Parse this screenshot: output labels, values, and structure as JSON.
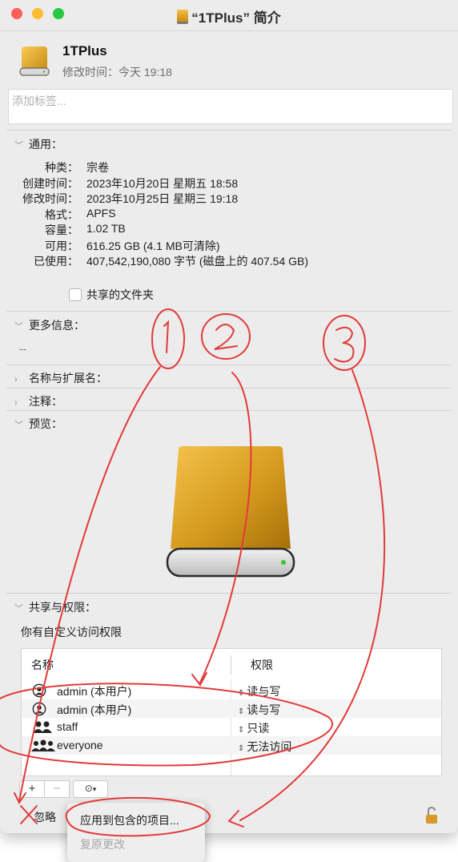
{
  "window": {
    "title": "“1TPlus” 简介",
    "name": "1TPlus",
    "modified": "修改时间：今天 19:18",
    "tag_placeholder": "添加标签..."
  },
  "general": {
    "header": "通用：",
    "rows": [
      {
        "label": "种类：",
        "value": "宗卷"
      },
      {
        "label": "创建时间：",
        "value": "2023年10月20日 星期五 18:58"
      },
      {
        "label": "修改时间：",
        "value": "2023年10月25日 星期三 19:18"
      },
      {
        "label": "格式：",
        "value": "APFS"
      },
      {
        "label": "容量：",
        "value": "1.02 TB"
      },
      {
        "label": "可用：",
        "value": "616.25 GB (4.1 MB可清除)"
      },
      {
        "label": "已使用：",
        "value": "407,542,190,080 字节 (磁盘上的 407.54 GB)"
      }
    ],
    "shared_folder": "共享的文件夹"
  },
  "more_info": {
    "header": "更多信息：",
    "value": "--"
  },
  "name_ext": {
    "header": "名称与扩展名："
  },
  "comments": {
    "header": "注释："
  },
  "preview": {
    "header": "预览："
  },
  "sharing": {
    "header": "共享与权限：",
    "note": "你有自定义访问权限",
    "col_name": "名称",
    "col_perm": "权限",
    "rows": [
      {
        "name": "admin (本用户)",
        "perm": "读与写",
        "icon": "user-icon"
      },
      {
        "name": "admin (本用户)",
        "perm": "读与写",
        "icon": "user-icon"
      },
      {
        "name": "staff",
        "perm": "只读",
        "icon": "group-icon"
      },
      {
        "name": "everyone",
        "perm": "无法访问",
        "icon": "everyone-icon"
      }
    ],
    "add": "+",
    "remove": "−",
    "ignore_label": "忽略"
  },
  "menu": {
    "apply": "应用到包含的项目...",
    "revert": "复原更改"
  },
  "annotations": {
    "circles": [
      "1",
      "2",
      "3"
    ],
    "color": "#e23a3a"
  },
  "colors": {
    "close": "#fe5f57",
    "minimize": "#febc2e",
    "zoom": "#28c840",
    "disk_gold": "#e2a62a",
    "annotation_red": "#e23a3a"
  }
}
